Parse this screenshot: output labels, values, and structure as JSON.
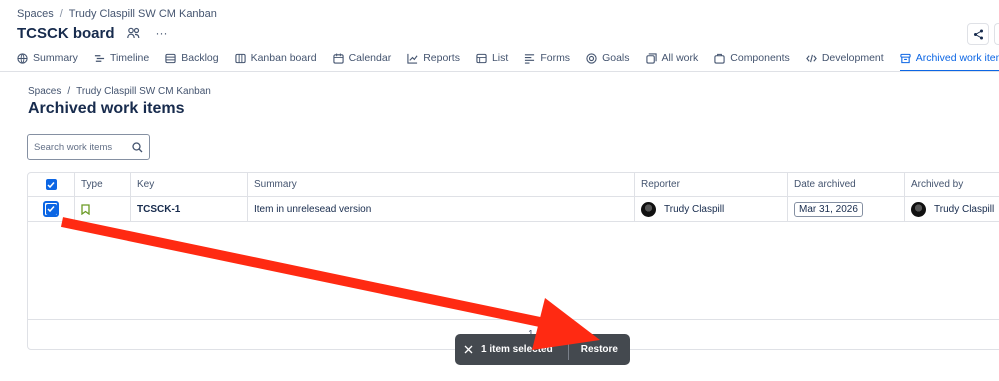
{
  "top_breadcrumb": {
    "spaces": "Spaces",
    "separator": "/",
    "project": "Trudy Claspill SW CM Kanban"
  },
  "board_title": "TCSCK board",
  "more_label": "···",
  "tabs": [
    {
      "label": "Summary",
      "icon": "globe-icon"
    },
    {
      "label": "Timeline",
      "icon": "timeline-icon"
    },
    {
      "label": "Backlog",
      "icon": "backlog-icon"
    },
    {
      "label": "Kanban board",
      "icon": "board-icon"
    },
    {
      "label": "Calendar",
      "icon": "calendar-icon"
    },
    {
      "label": "Reports",
      "icon": "chart-icon"
    },
    {
      "label": "List",
      "icon": "list-icon"
    },
    {
      "label": "Forms",
      "icon": "forms-icon"
    },
    {
      "label": "Goals",
      "icon": "target-icon"
    },
    {
      "label": "All work",
      "icon": "all-work-icon"
    },
    {
      "label": "Components",
      "icon": "component-icon"
    },
    {
      "label": "Development",
      "icon": "code-icon"
    },
    {
      "label": "Archived work items",
      "icon": "archive-icon",
      "active": true
    }
  ],
  "page_breadcrumb": {
    "spaces": "Spaces",
    "separator": "/",
    "project": "Trudy Claspill SW CM Kanban"
  },
  "page_title": "Archived work items",
  "search": {
    "placeholder": "Search work items"
  },
  "table": {
    "headers": [
      "Type",
      "Key",
      "Summary",
      "Reporter",
      "Date archived",
      "Archived by"
    ],
    "rows": [
      {
        "type_icon": "story-icon",
        "key": "TCSCK-1",
        "summary": "Item in unrelesead version",
        "reporter": "Trudy Claspill",
        "date_archived": "Mar 31, 2026",
        "archived_by": "Trudy Claspill"
      }
    ],
    "page_number": "1"
  },
  "toast": {
    "selected_text": "1 item selected",
    "restore_label": "Restore"
  },
  "colors": {
    "accent": "#0c66e4",
    "arrow": "#ff2a12",
    "toast_bg": "#44494f",
    "story_icon": "#6a9a23"
  }
}
